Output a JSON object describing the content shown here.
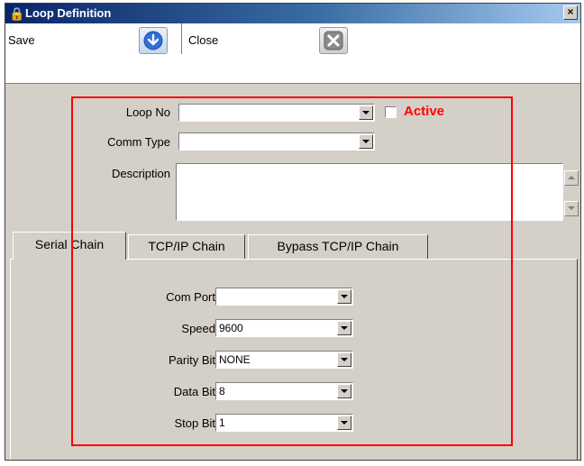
{
  "window": {
    "title": "Loop Definition",
    "close_glyph": "×",
    "title_icon": "lock-icon"
  },
  "toolbar": {
    "save_label": "Save",
    "close_label": "Close",
    "save_icon": "save-arrow-icon",
    "close_icon": "close-x-icon"
  },
  "form": {
    "loop_no_label": "Loop No",
    "loop_no_value": "",
    "active_label": "Active",
    "active_checked": false,
    "comm_type_label": "Comm Type",
    "comm_type_value": "",
    "description_label": "Description",
    "description_value": ""
  },
  "tabs": [
    {
      "label": "Serial Chain",
      "selected": true
    },
    {
      "label": "TCP/IP Chain",
      "selected": false
    },
    {
      "label": "Bypass TCP/IP Chain",
      "selected": false
    }
  ],
  "serial": {
    "com_port": {
      "label": "Com Port",
      "value": ""
    },
    "speed": {
      "label": "Speed",
      "value": "9600"
    },
    "parity_bit": {
      "label": "Parity Bit",
      "value": "NONE"
    },
    "data_bit": {
      "label": "Data Bit",
      "value": "8"
    },
    "stop_bit": {
      "label": "Stop Bit",
      "value": "1"
    }
  },
  "colors": {
    "highlight_box": "#ff0000",
    "active_text": "#ff0000",
    "titlebar": "#0a246a",
    "window_bg": "#d4d0c8"
  }
}
